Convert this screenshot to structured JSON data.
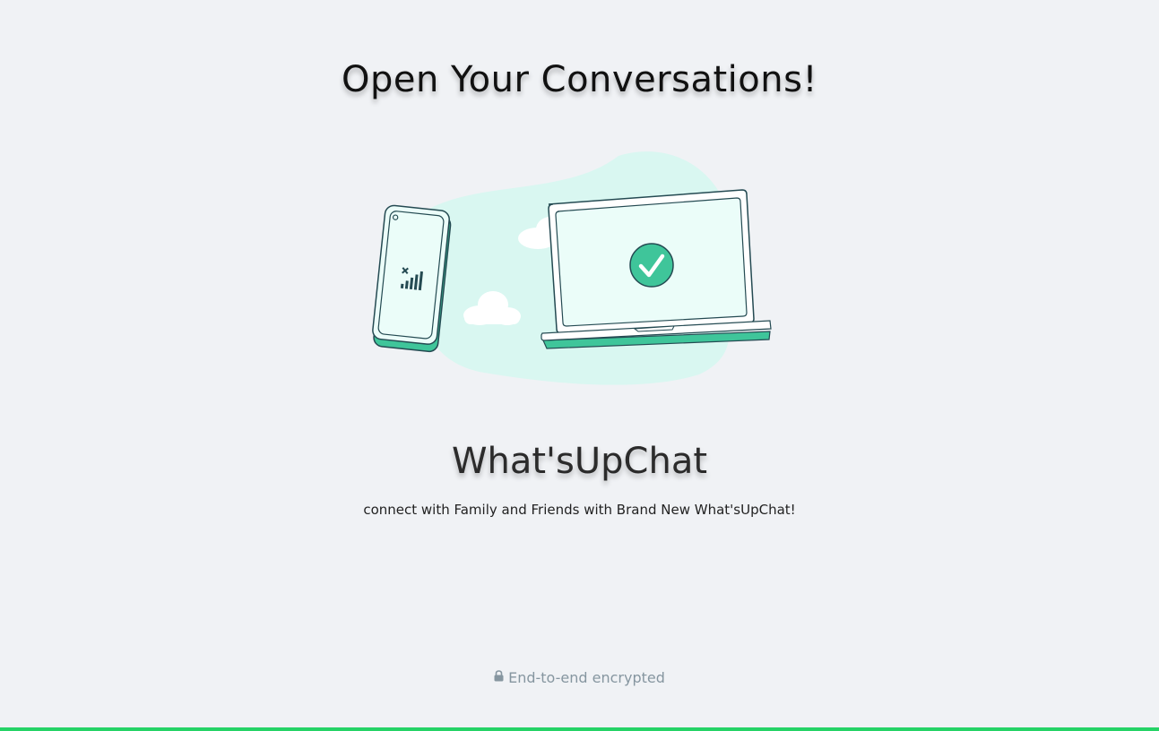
{
  "main": {
    "title": "Open Your Conversations!",
    "app_name": "What'sUpChat",
    "tagline": "connect with Family and Friends with Brand New What'sUpChat!",
    "illustration": {
      "icons": [
        "phone-icon",
        "signal-icon",
        "laptop-icon",
        "check-circle-icon",
        "cloud-icon"
      ]
    }
  },
  "footer": {
    "encryption_text": "End-to-end encrypted",
    "icon": "lock-icon"
  },
  "colors": {
    "background": "#f0f2f5",
    "accent": "#25d366",
    "illustration_green": "#3fc59a",
    "muted_text": "#8696a0"
  }
}
